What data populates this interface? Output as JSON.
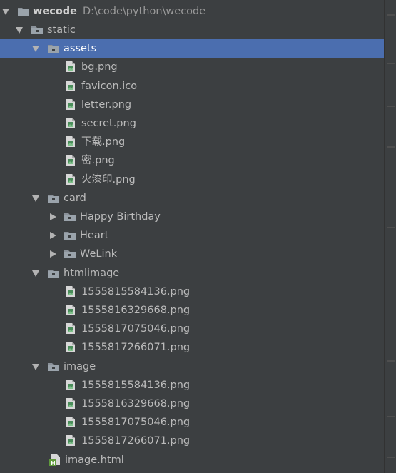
{
  "project": {
    "name": "wecode",
    "path": "D:\\code\\python\\wecode"
  },
  "nodes": [
    {
      "label": "static",
      "type": "folder",
      "expanded": true,
      "depth": 1
    },
    {
      "label": "assets",
      "type": "folder",
      "expanded": true,
      "depth": 2,
      "selected": true
    },
    {
      "label": "bg.png",
      "type": "image",
      "depth": 3
    },
    {
      "label": "favicon.ico",
      "type": "image",
      "depth": 3
    },
    {
      "label": "letter.png",
      "type": "image",
      "depth": 3
    },
    {
      "label": "secret.png",
      "type": "image",
      "depth": 3
    },
    {
      "label": "下载.png",
      "type": "image",
      "depth": 3
    },
    {
      "label": "密.png",
      "type": "image",
      "depth": 3
    },
    {
      "label": "火漆印.png",
      "type": "image",
      "depth": 3
    },
    {
      "label": "card",
      "type": "folder",
      "expanded": true,
      "depth": 2
    },
    {
      "label": "Happy Birthday",
      "type": "folder",
      "expanded": false,
      "depth": 3
    },
    {
      "label": "Heart",
      "type": "folder",
      "expanded": false,
      "depth": 3
    },
    {
      "label": "WeLink",
      "type": "folder",
      "expanded": false,
      "depth": 3
    },
    {
      "label": "htmlimage",
      "type": "folder",
      "expanded": true,
      "depth": 2
    },
    {
      "label": "1555815584136.png",
      "type": "image",
      "depth": 3
    },
    {
      "label": "1555816329668.png",
      "type": "image",
      "depth": 3
    },
    {
      "label": "1555817075046.png",
      "type": "image",
      "depth": 3
    },
    {
      "label": "1555817266071.png",
      "type": "image",
      "depth": 3
    },
    {
      "label": "image",
      "type": "folder",
      "expanded": true,
      "depth": 2
    },
    {
      "label": "1555815584136.png",
      "type": "image",
      "depth": 3
    },
    {
      "label": "1555816329668.png",
      "type": "image",
      "depth": 3
    },
    {
      "label": "1555817075046.png",
      "type": "image",
      "depth": 3
    },
    {
      "label": "1555817266071.png",
      "type": "image",
      "depth": 3
    },
    {
      "label": "image.html",
      "type": "html",
      "depth": 2
    }
  ],
  "icons": {
    "folder": "folder-icon",
    "image": "image-file-icon",
    "html": "html-file-icon",
    "expanded": "chevron-down-icon",
    "collapsed": "chevron-right-icon"
  },
  "colors": {
    "background": "#3c3f41",
    "selection": "#4b6eaf",
    "text": "#bbbbbb",
    "folder": "#8a9199",
    "image_icon_green": "#5c9e5c",
    "html_icon_green": "#6a9f4a"
  }
}
